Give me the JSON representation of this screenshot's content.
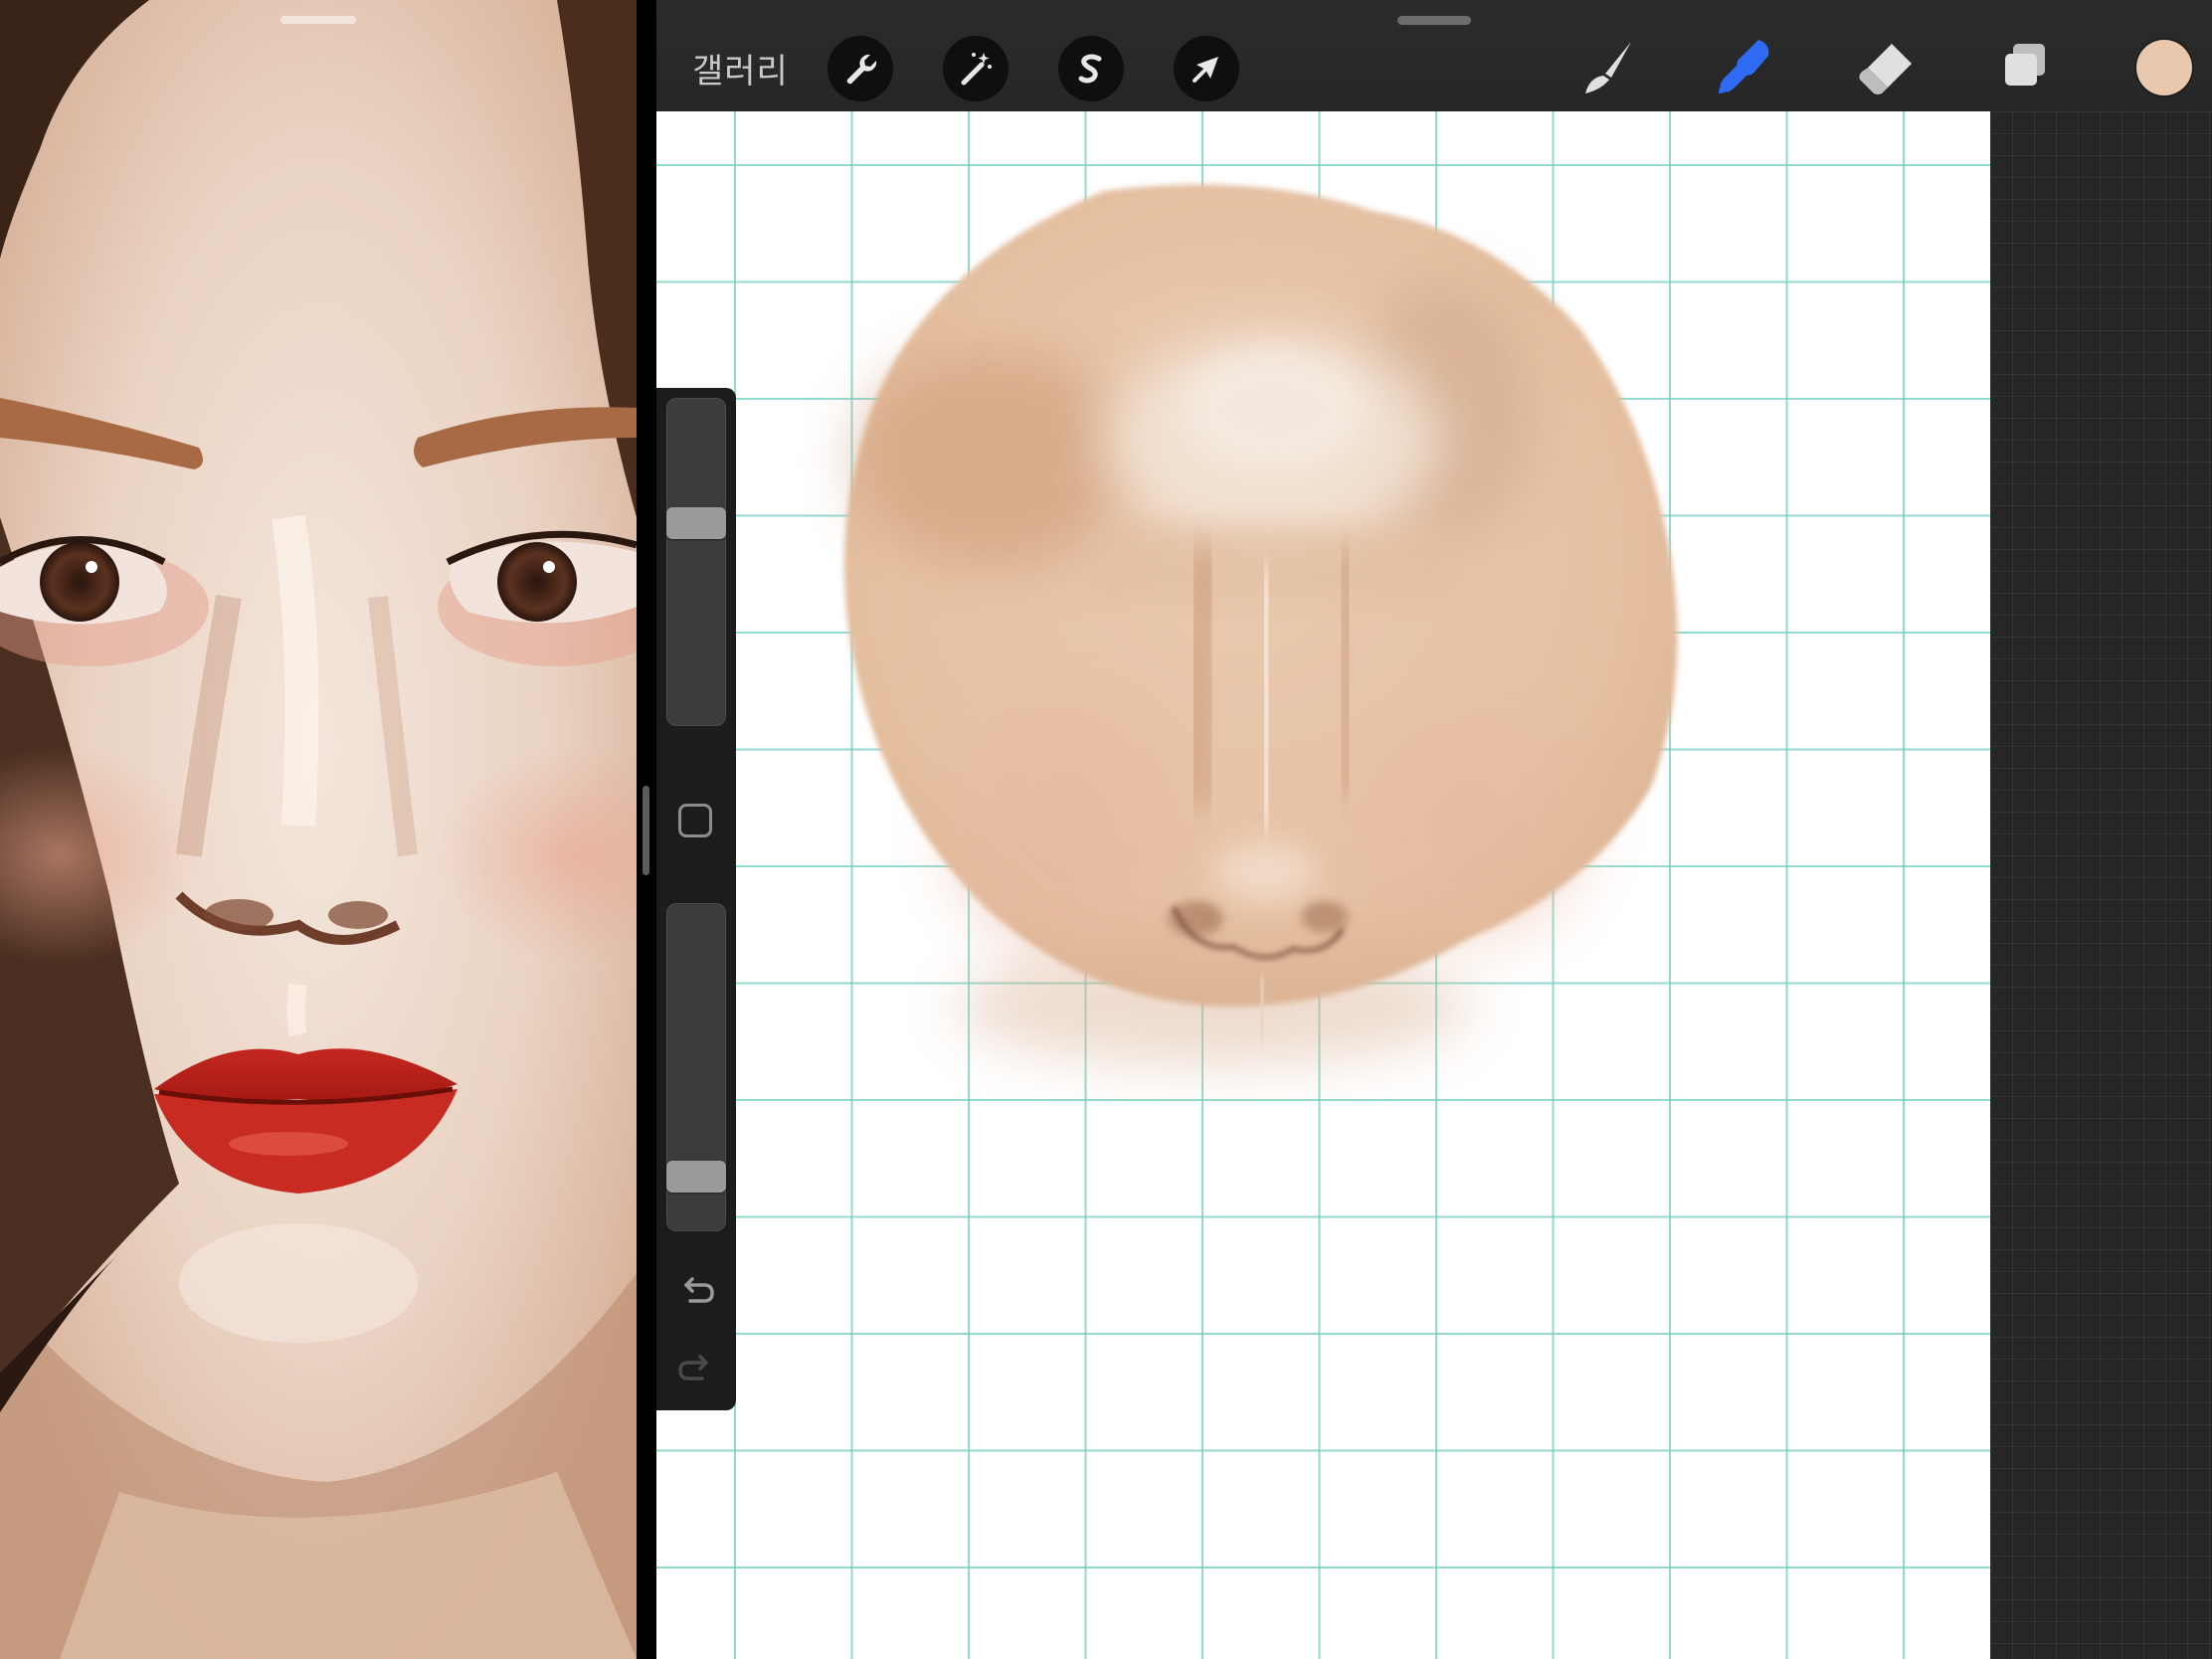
{
  "toolbar": {
    "gallery_label": "갤러리",
    "actions_icon": "wrench-icon",
    "adjustments_icon": "magic-wand-icon",
    "selection_icon": "selection-s-icon",
    "transform_icon": "arrow-cursor-icon",
    "brush_icon": "brush-icon",
    "smudge_icon": "smudge-finger-icon",
    "smudge_active": true,
    "eraser_icon": "eraser-icon",
    "layers_icon": "layers-icon",
    "active_tool_color": "#2f6bf2",
    "current_color": "#eac8ad"
  },
  "sidebar": {
    "brush_size_level": 0.63,
    "opacity_level": 0.13,
    "undo_icon": "undo-icon",
    "redo_icon": "redo-icon",
    "modify_button_icon": "square-modify-icon"
  },
  "canvas": {
    "grid_color": "#6ecdbe",
    "skin_base_color": "#e6c2a4",
    "skin_shadow_color": "#d4a27f"
  }
}
